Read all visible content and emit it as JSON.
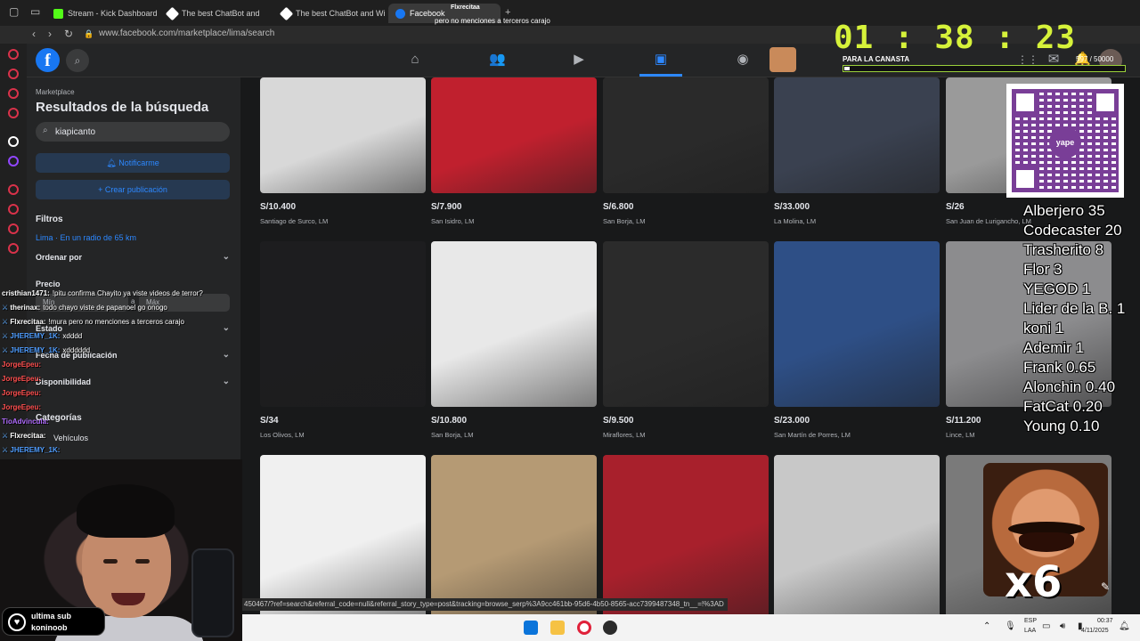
{
  "browser": {
    "tabs": [
      {
        "label": "Stream - Kick Dashboard",
        "color": "#53fc18"
      },
      {
        "label": "The best ChatBot and",
        "color": "#ffffff"
      },
      {
        "label": "The best ChatBot and Wi",
        "color": "#ffffff"
      },
      {
        "label": "Facebook",
        "color": "#1877f2",
        "active": true
      }
    ],
    "new_tab": "+",
    "url": "www.facebook.com/marketplace/lima/search"
  },
  "notification": {
    "title": "Flxrecitaa",
    "text": "pero no menciones a terceros carajo"
  },
  "facebook": {
    "logo": "f",
    "nav_icons": [
      "home-icon",
      "friends-icon",
      "watch-icon",
      "marketplace-icon",
      "groups-icon"
    ]
  },
  "marketplace": {
    "label": "Marketplace",
    "title": "Resultados de la búsqueda",
    "search_value": "kiapicanto",
    "notify_button": "Notificarme",
    "create_button": "+ Crear publicación",
    "filters_heading": "Filtros",
    "location": "Lima · En un radio de 65 km",
    "sort_label": "Ordenar por",
    "price_label": "Precio",
    "min_label": "Mín",
    "max_label": "Máx",
    "state_label": "Estado",
    "date_label": "Fecha de publicación",
    "availability_label": "Disponibilidad",
    "categories_label": "Categorías",
    "vehicles_label": "Vehículos"
  },
  "listings": [
    {
      "price": "S/10.400",
      "location": "Santiago de Surco, LM",
      "tone": "#d8d8d8"
    },
    {
      "price": "S/7.900",
      "location": "San Isidro, LM",
      "tone": "#c0202e"
    },
    {
      "price": "S/6.800",
      "location": "San Borja, LM",
      "tone": "#2a2a2a"
    },
    {
      "price": "S/33.000",
      "location": "La Molina, LM",
      "tone": "#3a4150"
    },
    {
      "price": "S/26",
      "location": "San Juan de Lurigancho, LM",
      "tone": "#9a9a9a"
    },
    {
      "price": "S/34",
      "location": "Los Olivos, LM",
      "tone": "#1d1d1f"
    },
    {
      "price": "S/10.800",
      "location": "San Borja, LM",
      "tone": "#e8e8e8"
    },
    {
      "price": "S/9.500",
      "location": "Miraflores, LM",
      "tone": "#2b2b2b"
    },
    {
      "price": "S/23.000",
      "location": "San Martín de Porres, LM",
      "tone": "#2e4f86"
    },
    {
      "price": "S/11.200",
      "location": "Lince, LM",
      "tone": "#8c8c8e"
    },
    {
      "price": "",
      "location": "",
      "tone": "#f0f0f0"
    },
    {
      "price": "",
      "location": "",
      "tone": "#b59a74"
    },
    {
      "price": "",
      "location": "",
      "tone": "#a8202c"
    },
    {
      "price": "",
      "location": "",
      "tone": "#c8c8c8"
    },
    {
      "price": "",
      "location": "",
      "tone": "#7a7a7a"
    }
  ],
  "overlay": {
    "timer": "01 : 38 : 23",
    "canasta_label": "PARA LA CANASTA",
    "canasta_count": "597 / 50000",
    "canasta_progress": 0.012,
    "qr_label": "yape",
    "donors": [
      "Alberjero 35",
      "Codecaster 20",
      "Trasherito 8",
      "Flor 3",
      "YEGOD 1",
      "Lider de la B. 1",
      "koni 1",
      "Ademir 1",
      "Frank 0.65",
      "Alonchin 0.40",
      "FatCat 0.20",
      "Young 0.10"
    ],
    "emote_multiplier": "x6"
  },
  "chat": [
    {
      "user": "cristhian1471:",
      "text": "!pitu confirma Chayito ya viste videos de terror?",
      "color": "#ffffff",
      "badge": false
    },
    {
      "user": "therinax:",
      "text": "todo chayo viste de papanoel go onogo",
      "color": "#ffffff",
      "badge": true
    },
    {
      "user": "Flxrecitaa:",
      "text": "!mura pero no menciones a terceros carajo",
      "color": "#ffffff",
      "badge": true
    },
    {
      "user": "JHEREMY_1K:",
      "text": "xdddd",
      "color": "#4f9dff",
      "badge": true
    },
    {
      "user": "JHEREMY_1K:",
      "text": "xdddddd",
      "color": "#4f9dff",
      "badge": true
    },
    {
      "user": "JorgeEpeu:",
      "text": "",
      "color": "#ff4f4f",
      "badge": false
    },
    {
      "user": "JorgeEpeu:",
      "text": "",
      "color": "#ff4f4f",
      "badge": false
    },
    {
      "user": "JorgeEpeu:",
      "text": "",
      "color": "#ff4f4f",
      "badge": false
    },
    {
      "user": "JorgeEpeu:",
      "text": "",
      "color": "#ff4f4f",
      "badge": false
    },
    {
      "user": "TioAdvincula:",
      "text": "",
      "color": "#b06cff",
      "badge": false
    },
    {
      "user": "Flxrecitaa:",
      "text": "",
      "color": "#ffffff",
      "badge": true
    },
    {
      "user": "JHEREMY_1K:",
      "text": "",
      "color": "#4f9dff",
      "badge": true
    }
  ],
  "subscription": {
    "line1": "ultima sub",
    "line2": "koninoob"
  },
  "status_url": "450467/?ref=search&referral_code=null&referral_story_type=post&tracking=browse_serp%3A9cc461bb-95d6-4b50-8565-acc7399487348_tn__=!%3AD",
  "taskbar": {
    "lang1": "ESP",
    "lang2": "LAA",
    "time": "00:37",
    "date": "4/11/2025"
  }
}
